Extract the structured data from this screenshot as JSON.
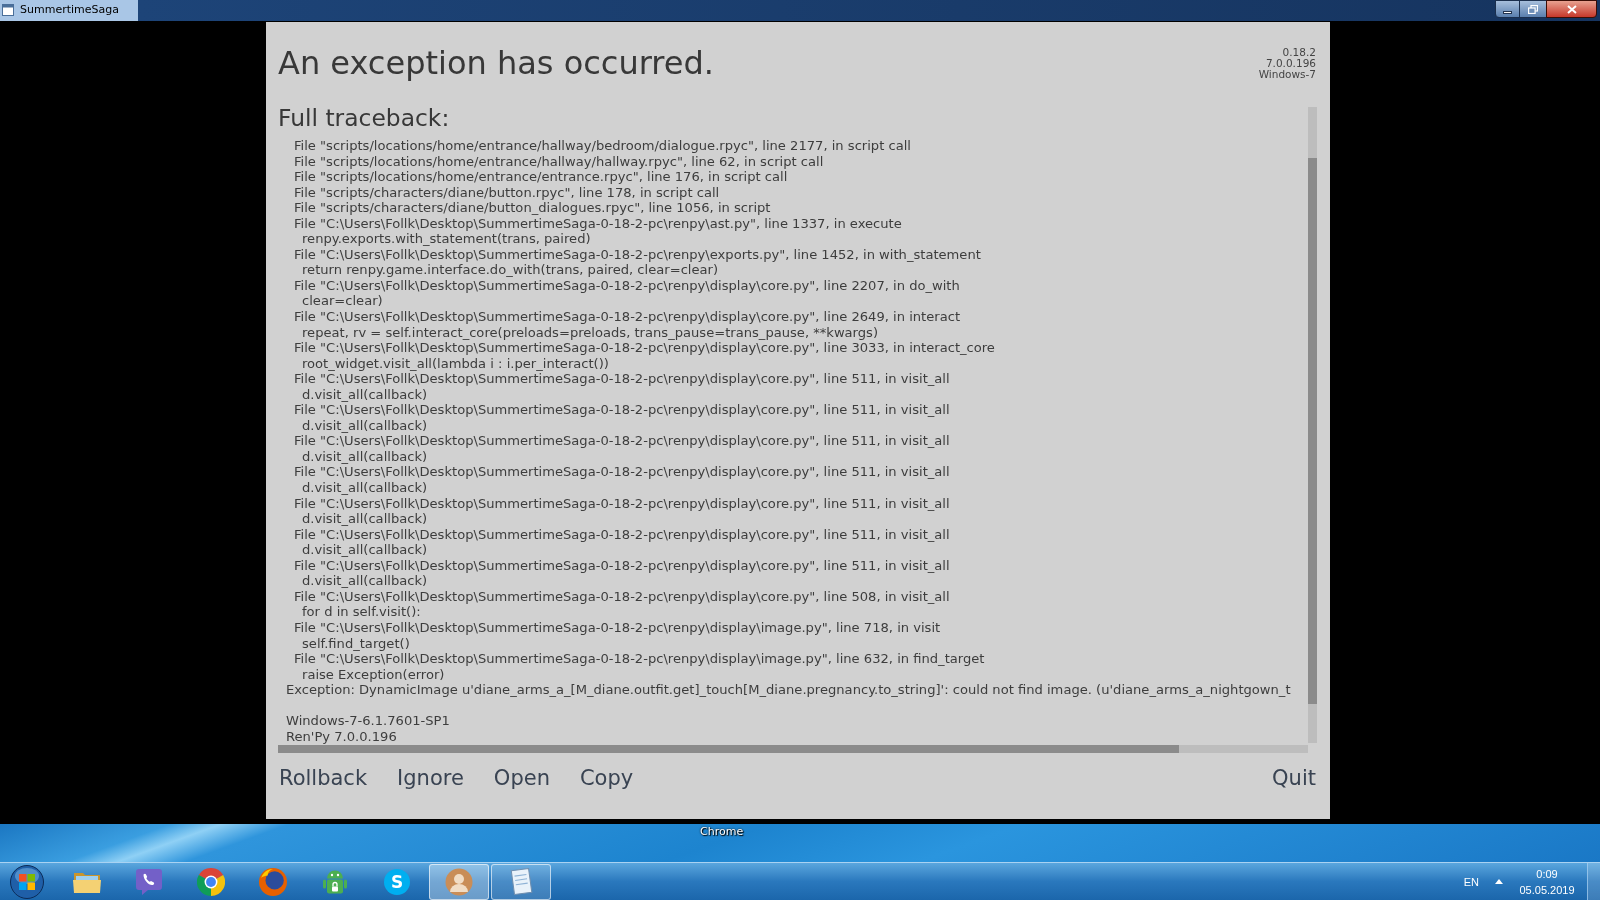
{
  "window": {
    "title": "SummertimeSaga"
  },
  "error_screen": {
    "heading": "An exception has occurred.",
    "version_info": [
      "0.18.2",
      "7.0.0.196",
      "Windows-7"
    ],
    "traceback": {
      "title": "Full traceback:",
      "frames": [
        {
          "location": "File \"scripts/locations/home/entrance/hallway/bedroom/dialogue.rpyc\", line 2177, in script call"
        },
        {
          "location": "File \"scripts/locations/home/entrance/hallway/hallway.rpyc\", line 62, in script call"
        },
        {
          "location": "File \"scripts/locations/home/entrance/entrance.rpyc\", line 176, in script call"
        },
        {
          "location": "File \"scripts/characters/diane/button.rpyc\", line 178, in script call"
        },
        {
          "location": "File \"scripts/characters/diane/button_dialogues.rpyc\", line 1056, in script"
        },
        {
          "location": "File \"C:\\Users\\Follk\\Desktop\\SummertimeSaga-0-18-2-pc\\renpy\\ast.py\", line 1337, in execute",
          "code": "renpy.exports.with_statement(trans, paired)"
        },
        {
          "location": "File \"C:\\Users\\Follk\\Desktop\\SummertimeSaga-0-18-2-pc\\renpy\\exports.py\", line 1452, in with_statement",
          "code": "return renpy.game.interface.do_with(trans, paired, clear=clear)"
        },
        {
          "location": "File \"C:\\Users\\Follk\\Desktop\\SummertimeSaga-0-18-2-pc\\renpy\\display\\core.py\", line 2207, in do_with",
          "code": "clear=clear)"
        },
        {
          "location": "File \"C:\\Users\\Follk\\Desktop\\SummertimeSaga-0-18-2-pc\\renpy\\display\\core.py\", line 2649, in interact",
          "code": "repeat, rv = self.interact_core(preloads=preloads, trans_pause=trans_pause, **kwargs)"
        },
        {
          "location": "File \"C:\\Users\\Follk\\Desktop\\SummertimeSaga-0-18-2-pc\\renpy\\display\\core.py\", line 3033, in interact_core",
          "code": "root_widget.visit_all(lambda i : i.per_interact())"
        },
        {
          "location": "File \"C:\\Users\\Follk\\Desktop\\SummertimeSaga-0-18-2-pc\\renpy\\display\\core.py\", line 511, in visit_all",
          "code": "d.visit_all(callback)"
        },
        {
          "location": "File \"C:\\Users\\Follk\\Desktop\\SummertimeSaga-0-18-2-pc\\renpy\\display\\core.py\", line 511, in visit_all",
          "code": "d.visit_all(callback)"
        },
        {
          "location": "File \"C:\\Users\\Follk\\Desktop\\SummertimeSaga-0-18-2-pc\\renpy\\display\\core.py\", line 511, in visit_all",
          "code": "d.visit_all(callback)"
        },
        {
          "location": "File \"C:\\Users\\Follk\\Desktop\\SummertimeSaga-0-18-2-pc\\renpy\\display\\core.py\", line 511, in visit_all",
          "code": "d.visit_all(callback)"
        },
        {
          "location": "File \"C:\\Users\\Follk\\Desktop\\SummertimeSaga-0-18-2-pc\\renpy\\display\\core.py\", line 511, in visit_all",
          "code": "d.visit_all(callback)"
        },
        {
          "location": "File \"C:\\Users\\Follk\\Desktop\\SummertimeSaga-0-18-2-pc\\renpy\\display\\core.py\", line 511, in visit_all",
          "code": "d.visit_all(callback)"
        },
        {
          "location": "File \"C:\\Users\\Follk\\Desktop\\SummertimeSaga-0-18-2-pc\\renpy\\display\\core.py\", line 511, in visit_all",
          "code": "d.visit_all(callback)"
        },
        {
          "location": "File \"C:\\Users\\Follk\\Desktop\\SummertimeSaga-0-18-2-pc\\renpy\\display\\core.py\", line 508, in visit_all",
          "code": "for d in self.visit():"
        },
        {
          "location": "File \"C:\\Users\\Follk\\Desktop\\SummertimeSaga-0-18-2-pc\\renpy\\display\\image.py\", line 718, in visit",
          "code": "self.find_target()"
        },
        {
          "location": "File \"C:\\Users\\Follk\\Desktop\\SummertimeSaga-0-18-2-pc\\renpy\\display\\image.py\", line 632, in find_target",
          "code": "raise Exception(error)"
        }
      ],
      "exception": "Exception: DynamicImage u'diane_arms_a_[M_diane.outfit.get]_touch[M_diane.pregnancy.to_string]': could not find image. (u'diane_arms_a_nightgown_t",
      "system_info": [
        "Windows-7-6.1.7601-SP1",
        "Ren'Py 7.0.0.196"
      ]
    },
    "actions": [
      "Rollback",
      "Ignore",
      "Open",
      "Copy"
    ],
    "quit_button": "Quit"
  },
  "desktop": {
    "icon_label": "Chrome"
  },
  "taskbar": {
    "apps": [
      {
        "kind": "folder",
        "running": false,
        "selected": false
      },
      {
        "kind": "chat-phone",
        "running": false,
        "selected": false
      },
      {
        "kind": "segment-circle",
        "running": false,
        "selected": false
      },
      {
        "kind": "fox-globe",
        "running": false,
        "selected": false
      },
      {
        "kind": "robot",
        "running": false,
        "selected": false
      },
      {
        "kind": "letter-circle",
        "glyph": "S",
        "running": false,
        "selected": false
      },
      {
        "kind": "avatar",
        "running": true,
        "selected": true
      },
      {
        "kind": "notepad",
        "running": true,
        "selected": false
      }
    ],
    "language": "EN",
    "time": "0:09",
    "date": "05.05.2019"
  }
}
